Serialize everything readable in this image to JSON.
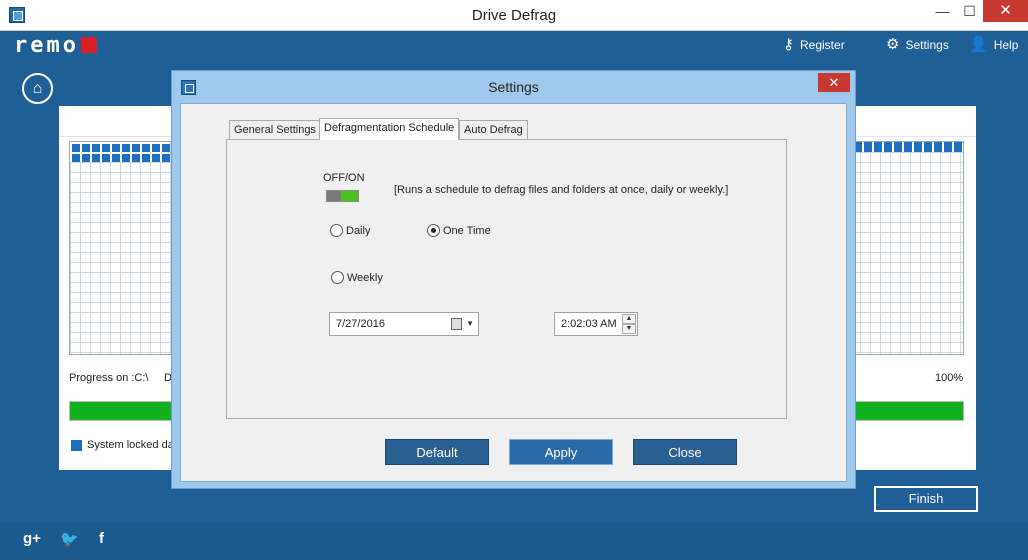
{
  "window": {
    "title": "Drive Defrag",
    "minimize": "—",
    "maximize": "☐",
    "close": "✕"
  },
  "header": {
    "logo": "remo",
    "register": "Register",
    "settings": "Settings",
    "help": "Help"
  },
  "main": {
    "progress_label": "Progress on :C:\\",
    "progress_label2": "D",
    "progress_pct": "100%",
    "progress_value": 100,
    "legend_text": "System locked da",
    "finish_label": "Finish"
  },
  "dialog": {
    "title": "Settings",
    "close": "✕",
    "tabs": [
      {
        "label": "General Settings"
      },
      {
        "label": "Defragmentation Schedule"
      },
      {
        "label": "Auto Defrag"
      }
    ],
    "offon_label": "OFF/ON",
    "description": "[Runs a schedule to defrag files and folders at once, daily or weekly.]",
    "radios": {
      "daily": "Daily",
      "one_time": "One Time",
      "weekly": "Weekly"
    },
    "selected_radio": "One Time",
    "date_value": "7/27/2016",
    "time_value": "2:02:03 AM",
    "buttons": {
      "default": "Default",
      "apply": "Apply",
      "close": "Close"
    }
  },
  "footer": {
    "gplus": "g+",
    "twitter": "🐦",
    "facebook": "f"
  },
  "colors": {
    "brand_blue": "#1f5f96",
    "progress_green": "#14b11e",
    "accent_red": "#d81f26"
  }
}
